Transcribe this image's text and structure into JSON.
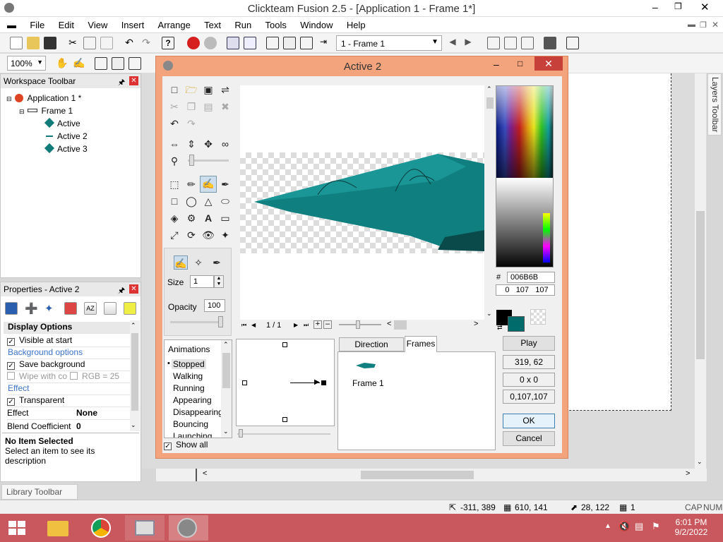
{
  "app": {
    "title": "Clickteam Fusion 2.5 - [Application 1 - Frame 1*]"
  },
  "menu": [
    "File",
    "Edit",
    "View",
    "Insert",
    "Arrange",
    "Text",
    "Run",
    "Tools",
    "Window",
    "Help"
  ],
  "toolbar": {
    "frame_select": "1 - Frame 1",
    "zoom": "100%"
  },
  "workspace": {
    "title": "Workspace Toolbar",
    "app_node": "Application 1 *",
    "frame_node": "Frame 1",
    "objects": [
      "Active",
      "Active 2",
      "Active 3"
    ]
  },
  "properties": {
    "title": "Properties - Active 2",
    "rows": [
      {
        "type": "header",
        "label": "Display Options"
      },
      {
        "type": "check",
        "label": "Visible at start",
        "checked": true
      },
      {
        "type": "section",
        "label": "Background options"
      },
      {
        "type": "check",
        "label": "Save background",
        "checked": true
      },
      {
        "type": "double",
        "label": "Wipe with co",
        "label2": "RGB = 25"
      },
      {
        "type": "section",
        "label": "Effect"
      },
      {
        "type": "check",
        "label": "Transparent",
        "checked": true
      },
      {
        "type": "kv",
        "label": "Effect",
        "value": "None"
      },
      {
        "type": "kv",
        "label": "Blend Coefficient",
        "value": "0"
      }
    ],
    "desc_title": "No Item Selected",
    "desc_text": "Select an item to see its description"
  },
  "library": {
    "title": "Library Toolbar"
  },
  "layers": {
    "title": "Layers Toolbar"
  },
  "dialog": {
    "title": "Active 2",
    "size_label": "Size",
    "size_value": "1",
    "opacity_label": "Opacity",
    "opacity_value": "100",
    "page_indicator": "1 / 1",
    "color_hex_label": "#",
    "color_hex": "006B6B",
    "color_rgb": "0   107   107",
    "animations_title": "Animations",
    "animations": [
      "Stopped",
      "Walking",
      "Running",
      "Appearing",
      "Disappearing",
      "Bouncing",
      "Launching"
    ],
    "show_all": "Show all",
    "tabs": [
      "Direction Options",
      "Frames"
    ],
    "frame_label": "Frame 1",
    "play": "Play",
    "info": [
      "319, 62",
      "0 x 0",
      "0,107,107"
    ],
    "ok": "OK",
    "cancel": "Cancel"
  },
  "statusbar": {
    "coords": "-311, 389",
    "size": "610, 141",
    "cursor": "28, 122",
    "sel": "1",
    "cap": "CAP",
    "num": "NUM"
  },
  "taskbar": {
    "time": "6:01 PM",
    "date": "9/2/2022"
  },
  "colors": {
    "accent": "#006B6B",
    "dialog_frame": "#F3A47D",
    "taskbar": "#C8585D"
  }
}
